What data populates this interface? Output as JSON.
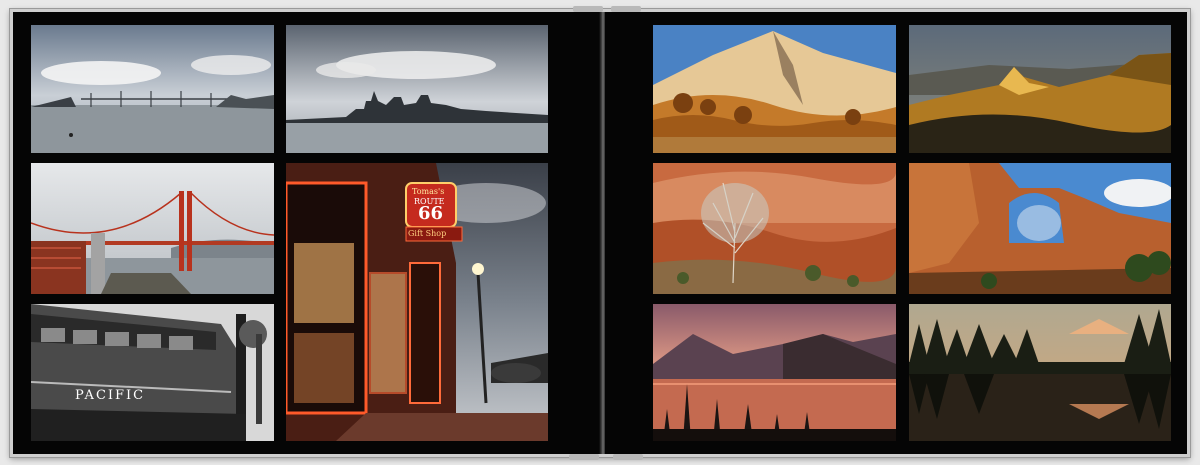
{
  "album": {
    "left_page": {
      "photos": [
        {
          "id": "sf-bay-bridge",
          "description_icon": "bay-bridge-photo"
        },
        {
          "id": "sf-skyline",
          "description_icon": "skyline-photo"
        },
        {
          "id": "golden-gate",
          "description_icon": "golden-gate-photo"
        },
        {
          "id": "route66-shop",
          "description_icon": "route66-shop-photo",
          "sign_text": [
            "Tomas's",
            "ROUTE",
            "66",
            "Gift Shop"
          ]
        },
        {
          "id": "pacific-train",
          "description_icon": "train-photo",
          "sign_text": "PACIFIC"
        }
      ]
    },
    "right_page": {
      "photos": [
        {
          "id": "desert-mountain",
          "description_icon": "desert-mountain-photo"
        },
        {
          "id": "golden-ridge",
          "description_icon": "golden-ridge-photo"
        },
        {
          "id": "red-rock-bush",
          "description_icon": "red-rock-photo"
        },
        {
          "id": "stone-arch",
          "description_icon": "stone-arch-photo"
        },
        {
          "id": "sunset-lake",
          "description_icon": "sunset-lake-photo"
        },
        {
          "id": "forest-reflection",
          "description_icon": "forest-reflection-photo"
        }
      ]
    }
  },
  "colors": {
    "page_bg": "#050505",
    "frame": "#cfcfcf",
    "outer_bg": "#e9e9e9"
  }
}
